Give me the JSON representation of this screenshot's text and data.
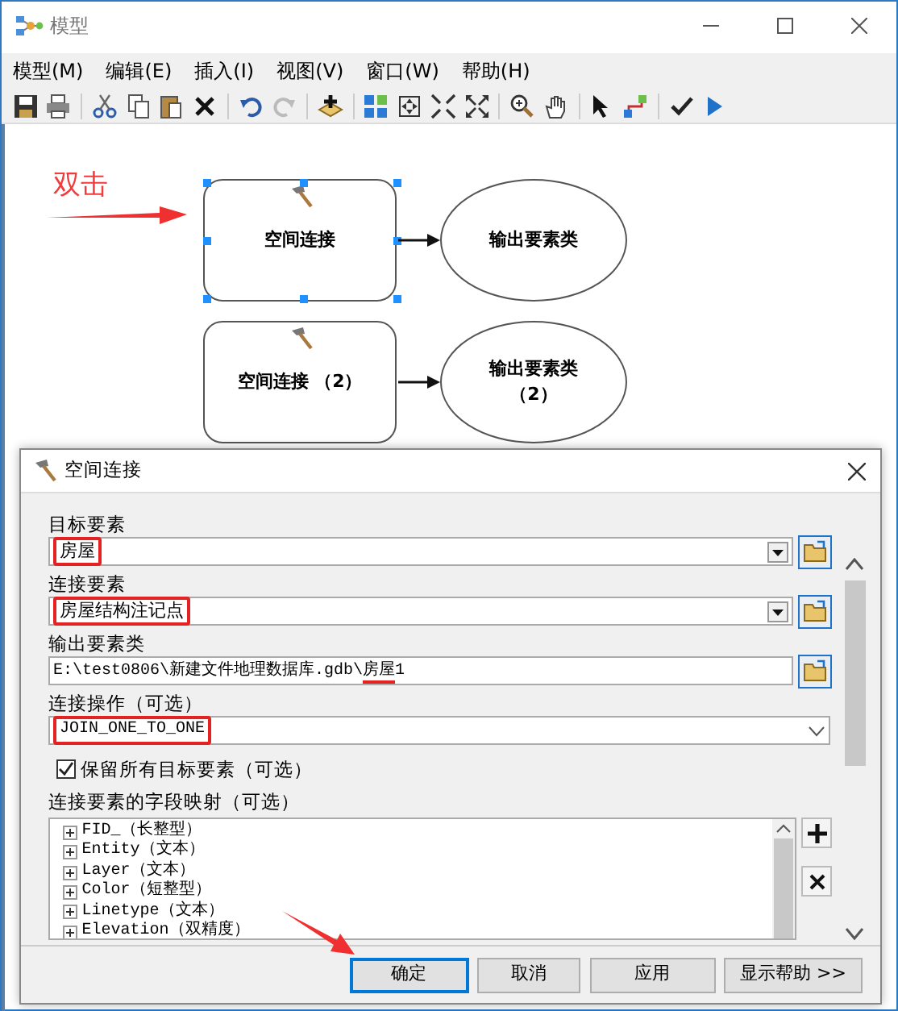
{
  "window": {
    "title": "模型"
  },
  "menu": [
    "模型(M)",
    "编辑(E)",
    "插入(I)",
    "视图(V)",
    "窗口(W)",
    "帮助(H)"
  ],
  "canvas": {
    "annotation": "双击",
    "processes": [
      {
        "tool": {
          "label": "空间连接",
          "selected": true
        },
        "output": {
          "label_lines": [
            "输出要素类"
          ]
        }
      },
      {
        "tool": {
          "label": "空间连接 （2）",
          "selected": false
        },
        "output": {
          "label_lines": [
            "输出要素类",
            "（2）"
          ]
        }
      }
    ]
  },
  "dialog": {
    "title": "空间连接",
    "params": [
      {
        "kind": "dropdown",
        "label": "目标要素",
        "highlighted": true,
        "value_parts": [
          {
            "text": "房屋",
            "marked": false
          }
        ]
      },
      {
        "kind": "dropdown",
        "label": "连接要素",
        "highlighted": true,
        "value_parts": [
          {
            "text": "房屋结构注记点",
            "marked": false
          }
        ]
      },
      {
        "kind": "text",
        "label": "输出要素类",
        "highlighted": false,
        "value_parts": [
          {
            "text": "E:\\test0806\\新建文件地理数据库.gdb\\",
            "marked": false
          },
          {
            "text": "房屋",
            "marked": true
          },
          {
            "text": "1",
            "marked": false
          }
        ]
      },
      {
        "kind": "combo",
        "label": "连接操作（可选）",
        "highlighted": true,
        "value_parts": [
          {
            "text": "JOIN_ONE_TO_ONE",
            "marked": false
          }
        ]
      }
    ],
    "checkbox": {
      "label": "保留所有目标要素（可选）",
      "checked": true
    },
    "field_map": {
      "label": "连接要素的字段映射（可选）",
      "items": [
        "FID_（长整型）",
        "Entity（文本）",
        "Layer（文本）",
        "Color（短整型）",
        "Linetype（文本）",
        "Elevation（双精度）"
      ]
    },
    "buttons": [
      {
        "label": "确定",
        "default": true
      },
      {
        "label": "取消",
        "default": false
      },
      {
        "label": "应用",
        "default": false
      },
      {
        "label": "显示帮助 >>",
        "default": false
      }
    ]
  }
}
